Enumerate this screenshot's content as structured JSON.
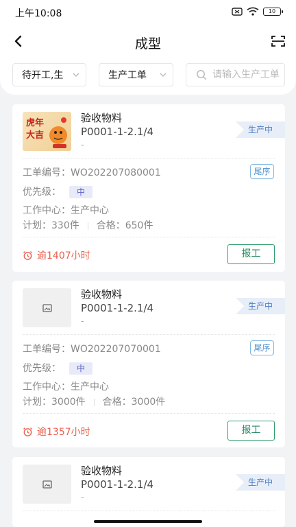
{
  "status_bar": {
    "time": "上午10:08",
    "battery": "10"
  },
  "nav": {
    "title": "成型"
  },
  "filters": {
    "status_select": "待开工,生",
    "process_select": "生产工单",
    "search_placeholder": "请输入生产工单"
  },
  "cards": [
    {
      "material_name": "验收物料",
      "material_code": "P0001-1-2.1/4",
      "material_spec": "-",
      "status": "生产中",
      "order_label": "工单编号：",
      "order_no": "WO202207080001",
      "tail_tag": "尾序",
      "priority_label": "优先级：",
      "priority": "中",
      "work_center_label": "工作中心：",
      "work_center": "生产中心",
      "plan": "计划：330件",
      "qualified": "合格：650件",
      "overdue": "逾1407小时",
      "report_button": "报工",
      "thumb": "photo",
      "thumb_text": "虎年大吉"
    },
    {
      "material_name": "验收物料",
      "material_code": "P0001-1-2.1/4",
      "material_spec": "-",
      "status": "生产中",
      "order_label": "工单编号：",
      "order_no": "WO202207070001",
      "tail_tag": "尾序",
      "priority_label": "优先级：",
      "priority": "中",
      "work_center_label": "工作中心：",
      "work_center": "生产中心",
      "plan": "计划：3000件",
      "qualified": "合格：3000件",
      "overdue": "逾1357小时",
      "report_button": "报工",
      "thumb": "placeholder"
    },
    {
      "material_name": "验收物料",
      "material_code": "P0001-1-2.1/4",
      "material_spec": "-",
      "status": "生产中",
      "thumb": "placeholder"
    }
  ],
  "colors": {
    "accent_green": "#1f8a5a",
    "overdue_red": "#e9604f",
    "status_blue": "#4a7cc6",
    "priority_purple": "#5a63c8"
  }
}
